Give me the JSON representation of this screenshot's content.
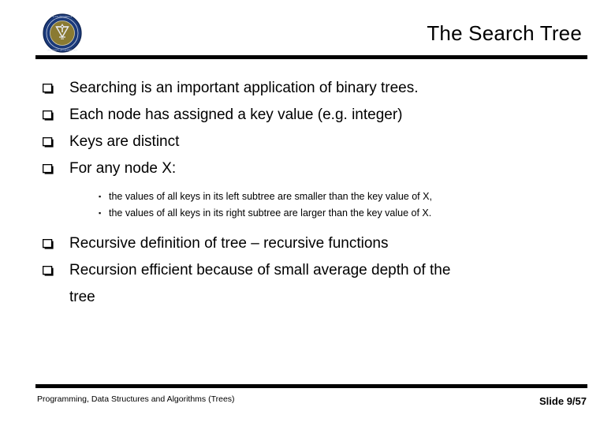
{
  "slide": {
    "title": "The Search Tree",
    "background_color": "#ffffff",
    "text_color": "#000000",
    "rule_color": "#000000"
  },
  "logo": {
    "name": "university-seal-logo",
    "ring_color": "#1b3a7a",
    "inner_color": "#8a7a32",
    "emblem_color": "#e8eaf0"
  },
  "bullets": [
    {
      "marker": "hollow-square-bullet",
      "text": "Searching is an important application of binary trees."
    },
    {
      "marker": "hollow-square-bullet",
      "text": "Each node has assigned a key value (e.g. integer)"
    },
    {
      "marker": "hollow-square-bullet",
      "text": "Keys are distinct"
    },
    {
      "marker": "hollow-square-bullet",
      "text": "For any node X:"
    }
  ],
  "subbullets": [
    {
      "marker": "small-filled-square-bullet",
      "text": "the values of all keys in its left subtree are smaller than the key value of X,"
    },
    {
      "marker": "small-filled-square-bullet",
      "text": "the values of all keys in its right subtree are larger than the key value of X."
    }
  ],
  "bullets_after": [
    {
      "marker": "hollow-square-bullet",
      "text": "Recursive definition of tree – recursive functions"
    },
    {
      "marker": "hollow-square-bullet",
      "text": "Recursion efficient because of small average depth of the"
    }
  ],
  "continuation_line": "tree",
  "footer": {
    "left_text": "Programming, Data Structures and Algorithms  (Trees)",
    "slide_number": "Slide 9/57"
  }
}
